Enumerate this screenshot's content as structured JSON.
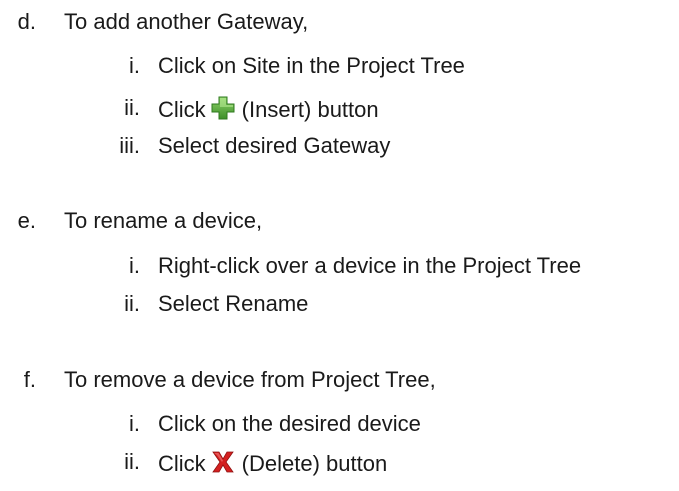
{
  "sections": [
    {
      "marker": "d.",
      "text": "To add another Gateway,",
      "steps": [
        {
          "marker": "i.",
          "text": "Click on Site in the Project Tree"
        },
        {
          "marker": "ii.",
          "text_before": "Click",
          "icon": "insert-plus-icon",
          "text_after": "(Insert) button"
        },
        {
          "marker": "iii.",
          "text": "Select desired Gateway"
        }
      ]
    },
    {
      "marker": "e.",
      "text": "To rename a device,",
      "steps": [
        {
          "marker": "i.",
          "text": "Right-click over a device in the Project Tree"
        },
        {
          "marker": "ii.",
          "text": "Select Rename"
        }
      ]
    },
    {
      "marker": "f.",
      "text": "To remove a device from Project Tree,",
      "steps": [
        {
          "marker": "i.",
          "text": "Click on the desired device"
        },
        {
          "marker": "ii.",
          "text_before": "Click",
          "icon": "delete-x-icon",
          "text_after": "(Delete) button"
        }
      ]
    }
  ],
  "colors": {
    "text": "#1a1a1a",
    "insert_icon": "#5aa83c",
    "delete_icon": "#d42020"
  }
}
